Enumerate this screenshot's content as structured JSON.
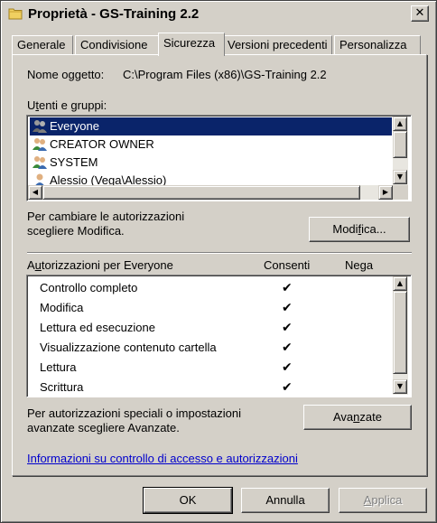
{
  "window": {
    "title": "Proprietà - GS-Training 2.2",
    "close_glyph": "✕"
  },
  "tabs": [
    {
      "label": "Generale",
      "active": false
    },
    {
      "label": "Condivisione",
      "active": false
    },
    {
      "label": "Sicurezza",
      "active": true
    },
    {
      "label": "Versioni precedenti",
      "active": false
    },
    {
      "label": "Personalizza",
      "active": false
    }
  ],
  "security": {
    "object_name_label": "Nome oggetto:",
    "object_name_value": "C:\\Program Files (x86)\\GS-Training 2.2",
    "groups_label_pre": "U",
    "groups_label_ul": "t",
    "groups_label_post": "enti e gruppi:",
    "users": [
      {
        "name": "Everyone",
        "icon": "group-icon",
        "selected": true
      },
      {
        "name": "CREATOR OWNER",
        "icon": "group-icon",
        "selected": false
      },
      {
        "name": "SYSTEM",
        "icon": "group-icon",
        "selected": false
      },
      {
        "name": "Alessio (Vega\\Alessio)",
        "icon": "user-icon",
        "selected": false
      }
    ],
    "change_hint_line1": "Per cambiare le autorizzazioni",
    "change_hint_line2": "scegliere Modifica.",
    "edit_button_pre": "Modi",
    "edit_button_ul": "f",
    "edit_button_post": "ica...",
    "permissions_label_pre": "A",
    "permissions_label_ul": "u",
    "permissions_label_post": "torizzazioni per Everyone",
    "allow_header": "Consenti",
    "deny_header": "Nega",
    "permissions": [
      {
        "name": "Controllo completo",
        "allow": true,
        "deny": false
      },
      {
        "name": "Modifica",
        "allow": true,
        "deny": false
      },
      {
        "name": "Lettura ed esecuzione",
        "allow": true,
        "deny": false
      },
      {
        "name": "Visualizzazione contenuto cartella",
        "allow": true,
        "deny": false
      },
      {
        "name": "Lettura",
        "allow": true,
        "deny": false
      },
      {
        "name": "Scrittura",
        "allow": true,
        "deny": false
      }
    ],
    "check_glyph": "✔",
    "advanced_hint_line1": "Per autorizzazioni speciali o impostazioni",
    "advanced_hint_line2": "avanzate scegliere Avanzate.",
    "advanced_button_pre": "Ava",
    "advanced_button_ul": "n",
    "advanced_button_post": "zate",
    "help_link": "Informazioni su controllo di accesso e autorizzazioni"
  },
  "footer": {
    "ok_label": "OK",
    "cancel_label": "Annulla",
    "apply_pre": "",
    "apply_ul": "A",
    "apply_post": "pplica"
  },
  "scroll": {
    "up": "▲",
    "down": "▼",
    "left": "◀",
    "right": "▶"
  }
}
